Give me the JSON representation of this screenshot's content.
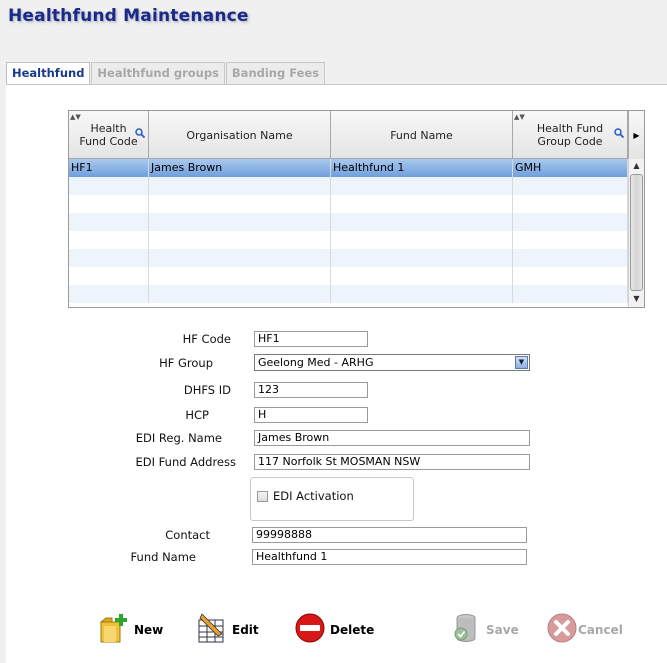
{
  "page": {
    "title": "Healthfund Maintenance"
  },
  "tabs": [
    {
      "label": "Healthfund",
      "active": true
    },
    {
      "label": "Healthfund groups",
      "active": false
    },
    {
      "label": "Banding Fees",
      "active": false
    }
  ],
  "grid": {
    "columns": [
      {
        "label": "Health Fund Code",
        "searchable": true
      },
      {
        "label": "Organisation Name",
        "searchable": false
      },
      {
        "label": "Fund Name",
        "searchable": false
      },
      {
        "label": "Health Fund Group Code",
        "searchable": true
      }
    ],
    "rows": [
      {
        "code": "HF1",
        "organisation": "James Brown",
        "fund": "Healthfund 1",
        "group_code": "GMH",
        "selected": true
      }
    ]
  },
  "form": {
    "hf_code": {
      "label": "HF Code",
      "value": "HF1"
    },
    "hf_group": {
      "label": "HF Group",
      "value": "Geelong Med - ARHG"
    },
    "dhfs_id": {
      "label": "DHFS ID",
      "value": "123"
    },
    "hcp": {
      "label": "HCP",
      "value": "H"
    },
    "edi_reg_name": {
      "label": "EDI Reg. Name",
      "value": "James Brown"
    },
    "edi_fund_address": {
      "label": "EDI Fund Address",
      "value": "117 Norfolk St MOSMAN NSW"
    },
    "edi_activation": {
      "label": "EDI Activation",
      "checked": false
    },
    "contact": {
      "label": "Contact",
      "value": "99998888"
    },
    "fund_name": {
      "label": "Fund Name",
      "value": "Healthfund 1"
    }
  },
  "toolbar": {
    "new_label": "New",
    "edit_label": "Edit",
    "delete_label": "Delete",
    "save_label": "Save",
    "cancel_label": "Cancel"
  },
  "colors": {
    "title": "#1a2a86",
    "active_tab": "#1a3a8a",
    "selected_row": "#8fb4e6",
    "delete_red": "#d81818"
  }
}
